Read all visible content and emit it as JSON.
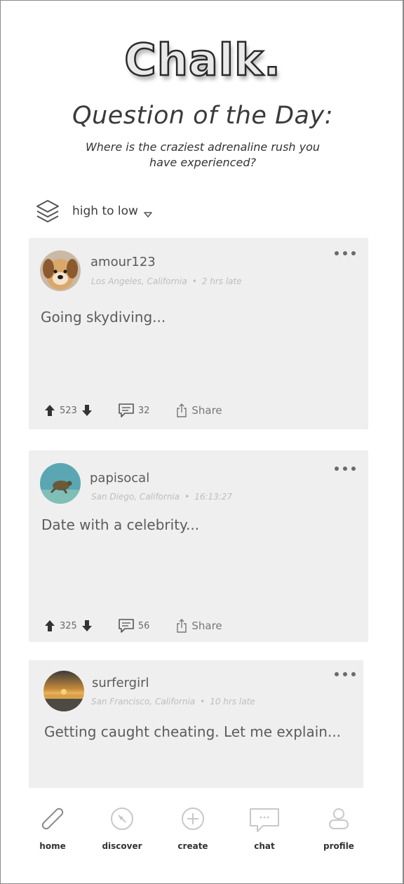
{
  "app": {
    "logo": "Chalk."
  },
  "qotd": {
    "title": "Question of the Day:",
    "question": "Where is the craziest adrenaline rush you have experienced?"
  },
  "sort": {
    "label": "high to low",
    "icon": "layers-icon"
  },
  "posts": [
    {
      "username": "amour123",
      "location": "Los Angeles, California",
      "time": "2 hrs late",
      "text": "Going skydiving...",
      "votes": "523",
      "comments": "32",
      "share_label": "Share",
      "avatar": "dog-photo"
    },
    {
      "username": "papisocal",
      "location": "San Diego, California",
      "time": "16:13:27",
      "text": "Date with a celebrity...",
      "votes": "325",
      "comments": "56",
      "share_label": "Share",
      "avatar": "sea-turtle-photo"
    },
    {
      "username": "surfergirl",
      "location": "San Francisco, California",
      "time": "10 hrs late",
      "text": "Getting caught cheating. Let me explain...",
      "avatar": "sunset-beach-photo"
    }
  ],
  "nav": [
    {
      "label": "home",
      "icon": "pencil-icon"
    },
    {
      "label": "discover",
      "icon": "compass-icon"
    },
    {
      "label": "create",
      "icon": "plus-circle-icon"
    },
    {
      "label": "chat",
      "icon": "chat-bubble-icon"
    },
    {
      "label": "profile",
      "icon": "user-icon"
    }
  ],
  "colors": {
    "card": "#efefef",
    "text": "#5c5c5c",
    "meta": "#bdbdbd",
    "icon_light": "#c8c8c8"
  }
}
